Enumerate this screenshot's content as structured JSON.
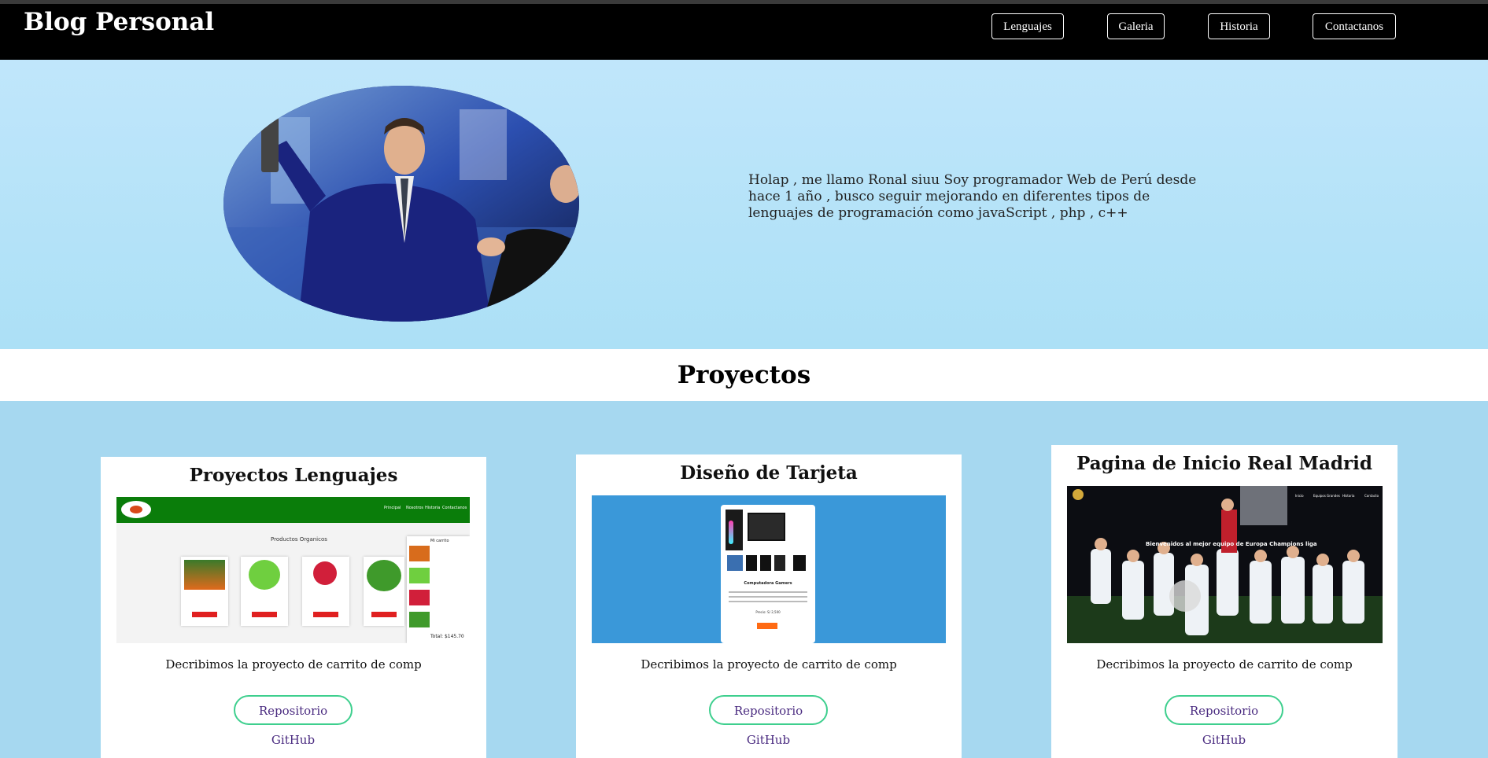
{
  "header": {
    "title": "Blog Personal",
    "nav": [
      "Lenguajes",
      "Galeria",
      "Historia",
      "Contactanos"
    ]
  },
  "hero": {
    "intro": "Holap , me llamo Ronal siuu Soy programador Web de Perú desde hace 1 año , busco seguir mejorando en diferentes tipos de lenguajes de programación como javaScript , php , c++"
  },
  "projects": {
    "heading": "Proyectos",
    "cards": [
      {
        "title": "Proyectos Lenguajes",
        "description": "Decribimos la proyecto de carrito de comp",
        "button": "Repositorio GitHub",
        "preview": {
          "nav": [
            "Principal",
            "Nosotros",
            "Historia",
            "Contactanos"
          ],
          "section_title": "Productos Organicos",
          "cart_title": "Mi carrito",
          "total": "Total: $145.70",
          "buy_label": "COMPRAR"
        }
      },
      {
        "title": "Diseño de Tarjeta",
        "description": "Decribimos la proyecto de carrito de comp",
        "button": "Repositorio GitHub",
        "preview": {
          "product_title": "Computadora Gamers",
          "price": "Precio: S/ 2,500",
          "button": "AGREGAR"
        }
      },
      {
        "title": "Pagina de Inicio Real Madrid",
        "description": "Decribimos la proyecto de carrito de comp",
        "button": "Repositorio GitHub",
        "preview": {
          "nav": [
            "Inicio",
            "Equipos Grandes",
            "Historia",
            "Contacto"
          ],
          "headline": "Bienvenidos al mejor equipo de Europa Champions liga"
        }
      }
    ]
  },
  "colors": {
    "header_bg": "#000000",
    "hero_bg": "#bfe5fa",
    "page_bg": "#a6d8f0",
    "button_border": "#3ecf8e",
    "button_text": "#4a2b80",
    "card_blue": "#3a98d9",
    "preview_green": "#0a7d0a"
  }
}
